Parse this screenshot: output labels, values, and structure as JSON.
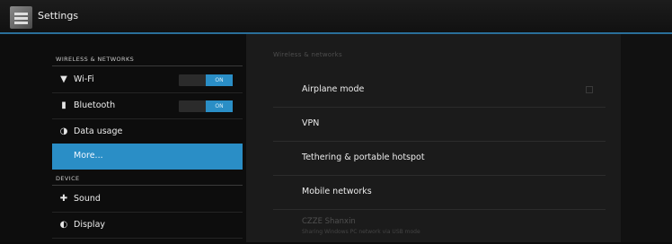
{
  "actionbar": {
    "title": "Settings",
    "icon": "settings-icon"
  },
  "sidebar": {
    "wireless_header": "WIRELESS & NETWORKS",
    "device_header": "DEVICE",
    "items": [
      {
        "label": "Wi-Fi",
        "icon": "wifi-icon",
        "toggle": "ON"
      },
      {
        "label": "Bluetooth",
        "icon": "bluetooth-icon",
        "toggle": "ON"
      },
      {
        "label": "Data usage",
        "icon": "data-usage-icon"
      },
      {
        "label": "More...",
        "icon": "",
        "selected": true
      },
      {
        "label": "Sound",
        "icon": "sound-icon"
      },
      {
        "label": "Display",
        "icon": "display-icon"
      }
    ]
  },
  "content": {
    "category": "Wireless & networks",
    "rows": [
      {
        "label": "Airplane mode",
        "checkbox": false
      },
      {
        "label": "VPN"
      },
      {
        "label": "Tethering & portable hotspot"
      },
      {
        "label": "Mobile networks"
      },
      {
        "label": "CZZE Shanxin",
        "summary": "Sharing Windows PC network via USB mode",
        "disabled": true
      }
    ]
  },
  "colors": {
    "accent": "#2a8ec6",
    "background": "#0b0b0b",
    "panel": "#1b1b1b"
  }
}
